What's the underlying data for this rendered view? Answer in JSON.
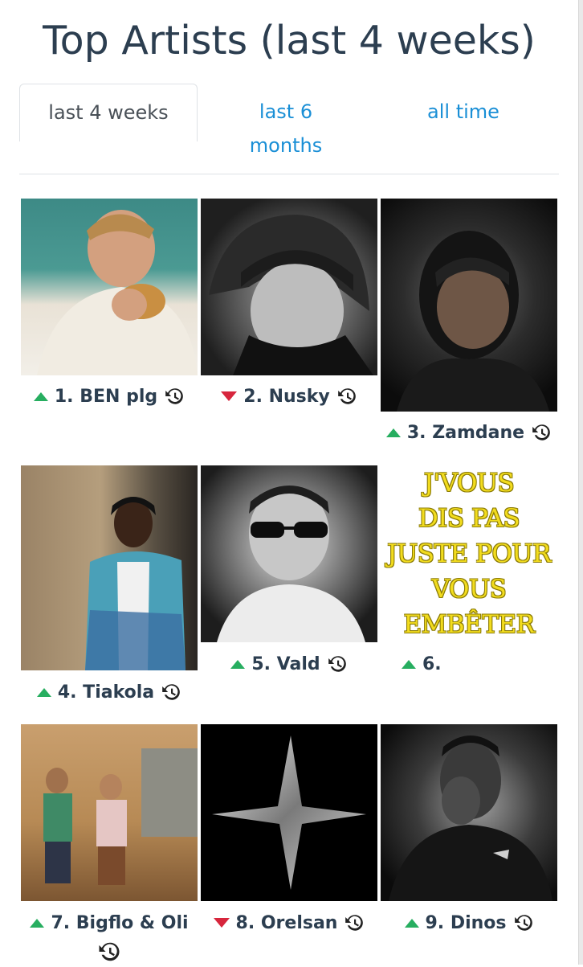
{
  "title": "Top Artists (last 4 weeks)",
  "tabs": [
    {
      "label": "last 4 weeks",
      "active": true
    },
    {
      "label": "last 6 months",
      "active": false
    },
    {
      "label": "all time",
      "active": false
    }
  ],
  "artists": [
    {
      "rank": 1,
      "label": "1. BEN plg",
      "trend": "up"
    },
    {
      "rank": 2,
      "label": "2. Nusky",
      "trend": "down"
    },
    {
      "rank": 3,
      "label": "3. Zamdane",
      "trend": "up"
    },
    {
      "rank": 4,
      "label": "4. Tiakola",
      "trend": "up"
    },
    {
      "rank": 5,
      "label": "5. Vald",
      "trend": "up"
    },
    {
      "rank": 6,
      "label": "6.",
      "trend": "up",
      "image_text": [
        "J'VOUS",
        "DIS PAS",
        "JUSTE POUR",
        "VOUS",
        "EMBÊTER"
      ]
    },
    {
      "rank": 7,
      "label": "7. Bigflo & Oli",
      "trend": "up"
    },
    {
      "rank": 8,
      "label": "8. Orelsan",
      "trend": "down"
    },
    {
      "rank": 9,
      "label": "9. Dinos",
      "trend": "up"
    }
  ],
  "colors": {
    "trend_up": "#27ae60",
    "trend_down": "#d7263d",
    "link": "#1a8fd6",
    "text": "#2c3e50"
  },
  "icons": {
    "history": "history-icon",
    "up": "triangle-up-icon",
    "down": "triangle-down-icon"
  }
}
